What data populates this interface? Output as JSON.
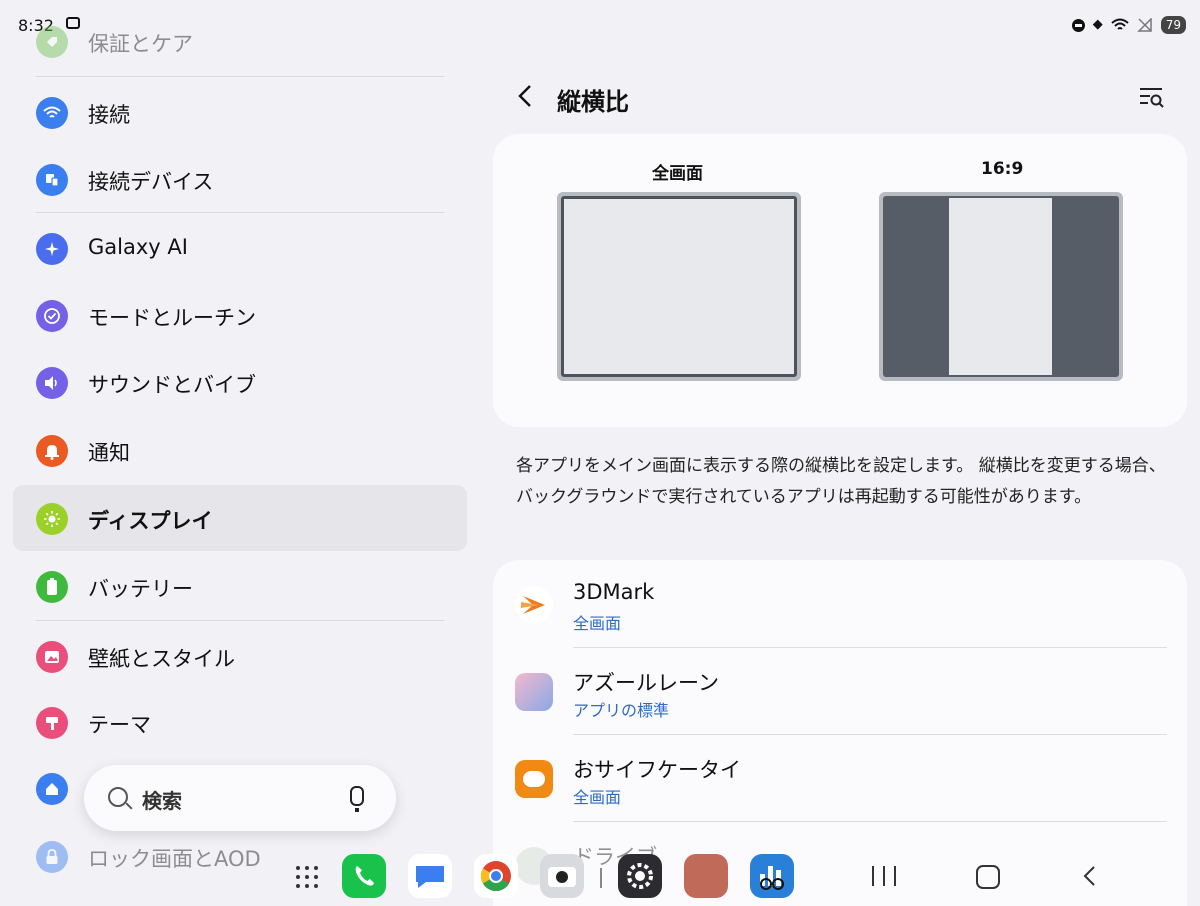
{
  "status_bar": {
    "time": "8:32",
    "battery": "79"
  },
  "sidebar": {
    "items": [
      {
        "label": "保証とケア",
        "color": "#6ec052",
        "icon": "tag-icon",
        "faded": true
      },
      {
        "label": "接続",
        "color": "#3b7ef0",
        "icon": "wifi-icon"
      },
      {
        "label": "接続デバイス",
        "color": "#3b7ef0",
        "icon": "devices-icon"
      },
      {
        "label": "Galaxy AI",
        "color": "#4a6df0",
        "icon": "sparkle-icon"
      },
      {
        "label": "モードとルーチン",
        "color": "#7561e8",
        "icon": "check-circle-icon"
      },
      {
        "label": "サウンドとバイブ",
        "color": "#7561e8",
        "icon": "speaker-icon"
      },
      {
        "label": "通知",
        "color": "#ea5a22",
        "icon": "bell-icon"
      },
      {
        "label": "ディスプレイ",
        "color": "#9bd028",
        "icon": "sun-icon",
        "active": true
      },
      {
        "label": "バッテリー",
        "color": "#3fba3f",
        "icon": "battery-icon"
      },
      {
        "label": "壁紙とスタイル",
        "color": "#ea4f7c",
        "icon": "image-icon"
      },
      {
        "label": "テーマ",
        "color": "#ea4f7c",
        "icon": "brush-icon"
      },
      {
        "label": "",
        "color": "#3b7ef0",
        "icon": "home-icon"
      },
      {
        "label": "ロック画面とAOD",
        "color": "#3b7ef0",
        "icon": "lock-icon",
        "faded": true
      }
    ],
    "search": {
      "placeholder": "検索"
    }
  },
  "header": {
    "title": "縦横比"
  },
  "preview": {
    "options": [
      {
        "label": "全画面"
      },
      {
        "label": "16:9"
      }
    ]
  },
  "description": "各アプリをメイン画面に表示する際の縦横比を設定します。 縦横比を変更する場合、バックグラウンドで実行されているアプリは再起動する可能性があります。",
  "apps": [
    {
      "name": "3DMark",
      "status": "全画面",
      "icon": "3dmark-icon",
      "color": "#f07a1e"
    },
    {
      "name": "アズールレーン",
      "status": "アプリの標準",
      "icon": "azur-lane-icon",
      "color": "#e07aa0"
    },
    {
      "name": "おサイフケータイ",
      "status": "全画面",
      "icon": "osaifu-keitai-icon",
      "color": "#f08a12"
    },
    {
      "name": "ドライブ",
      "status": "",
      "icon": "drive-icon",
      "color": "#cfd8cf"
    }
  ],
  "dock": {
    "apps": [
      {
        "name": "phone-app",
        "color": "#19c24a"
      },
      {
        "name": "messages-app",
        "color": "#ffffff"
      },
      {
        "name": "chrome-app",
        "color": "#ffffff"
      },
      {
        "name": "camera-app",
        "color": "#d8dadf"
      },
      {
        "name": "settings-app",
        "color": "#2c2c30"
      },
      {
        "name": "game-app",
        "color": "#c06a5a"
      },
      {
        "name": "benchmark-app",
        "color": "#2a7fd8"
      }
    ]
  }
}
